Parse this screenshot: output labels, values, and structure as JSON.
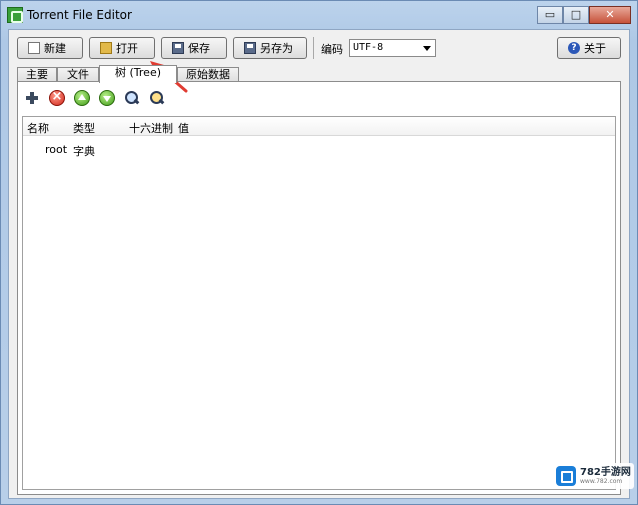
{
  "window": {
    "title": "Torrent File Editor",
    "controls": {
      "minimize": "▭",
      "maximize": "□",
      "close": "✕"
    }
  },
  "toolbar": {
    "new_label": "新建",
    "open_label": "打开",
    "save_label": "保存",
    "save_as_label": "另存为",
    "encoding_label": "编码",
    "encoding_value": "UTF-8",
    "about_label": "关于",
    "help_glyph": "?"
  },
  "tabs": [
    {
      "label": "主要"
    },
    {
      "label": "文件"
    },
    {
      "label": "树 (Tree)",
      "active": true
    },
    {
      "label": "原始数据"
    }
  ],
  "icons": [
    "add-icon",
    "delete-icon",
    "move-up-icon",
    "move-down-icon",
    "find-icon",
    "find-next-icon"
  ],
  "tree": {
    "columns": [
      "名称",
      "类型",
      "十六进制",
      "值"
    ],
    "rows": [
      {
        "name": "root",
        "type": "字典",
        "hex": "",
        "value": ""
      }
    ]
  },
  "annotation_color": "#e03c32",
  "watermark": {
    "main": "782手游网",
    "sub": "www.782.com"
  }
}
